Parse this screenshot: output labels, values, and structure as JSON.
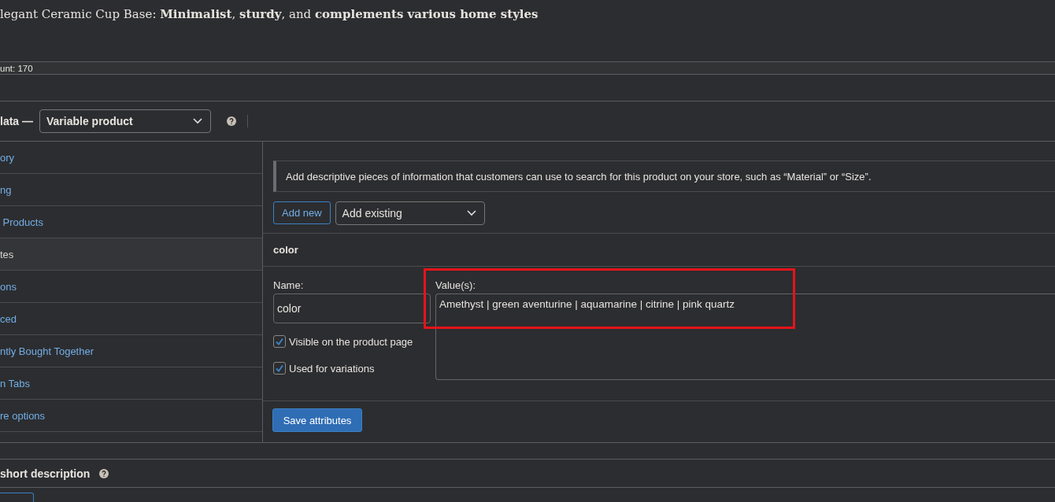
{
  "title": "legant Ceramic Cup Base: **Minimalist**, **sturdy**, and **complements various home styles**",
  "word_count": "unt: 170",
  "product_data": {
    "label": "lata —",
    "type_select": "Variable product"
  },
  "tabs": [
    {
      "label": "ory",
      "selected": false
    },
    {
      "label": "ng",
      "selected": false
    },
    {
      "label": " Products",
      "selected": false
    },
    {
      "label": "tes",
      "selected": true
    },
    {
      "label": "ons",
      "selected": false
    },
    {
      "label": "ced",
      "selected": false
    },
    {
      "label": "ntly Bought Together",
      "selected": false
    },
    {
      "label": "n Tabs",
      "selected": false
    },
    {
      "label": "re options",
      "selected": false
    }
  ],
  "attributes": {
    "notice": "Add descriptive pieces of information that customers can use to search for this product on your store, such as “Material” or “Size”.",
    "add_new": "Add new",
    "add_existing": "Add existing",
    "attribute": {
      "header": "color",
      "name_label": "Name:",
      "name_value": "color",
      "values_label": "Value(s):",
      "values": "Amethyst | green aventurine | aquamarine | citrine | pink quartz",
      "options": [
        {
          "label": "Visible on the product page",
          "checked": true
        },
        {
          "label": "Used for variations",
          "checked": true
        }
      ]
    },
    "save": "Save attributes"
  },
  "short_description": {
    "title": "short description"
  }
}
